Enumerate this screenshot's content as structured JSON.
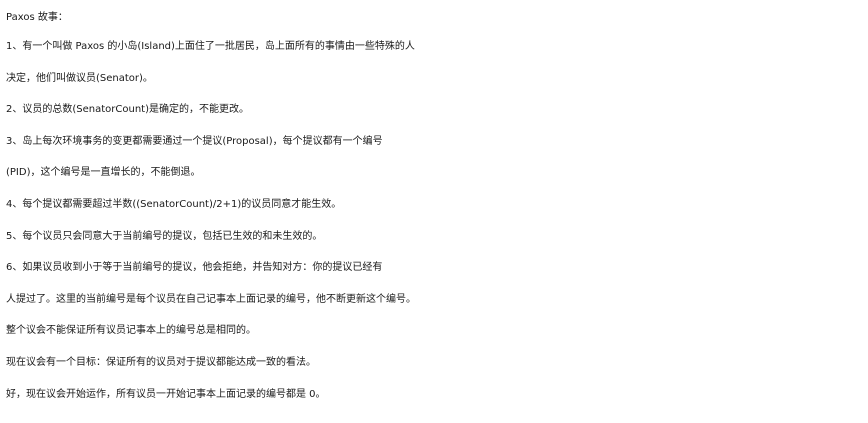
{
  "document": {
    "title": "Paxos  故事：",
    "lines": [
      "1、有一个叫做  Paxos  的小岛(Island)上面住了一批居民，岛上面所有的事情由一些特殊的人",
      "决定，他们叫做议员(Senator)。",
      "2、议员的总数(SenatorCount)是确定的，不能更改。",
      "3、岛上每次环境事务的变更都需要通过一个提议(Proposal)，每个提议都有一个编号",
      "(PID)，这个编号是一直增长的，不能倒退。",
      "4、每个提议都需要超过半数((SenatorCount)/2+1)的议员同意才能生效。",
      "5、每个议员只会同意大于当前编号的提议，包括已生效的和未生效的。",
      "6、如果议员收到小于等于当前编号的提议，他会拒绝，并告知对方：你的提议已经有",
      "人提过了。这里的当前编号是每个议员在自己记事本上面记录的编号，他不断更新这个编号。",
      "整个议会不能保证所有议员记事本上的编号总是相同的。",
      "现在议会有一个目标：保证所有的议员对于提议都能达成一致的看法。",
      "好，现在议会开始运作，所有议员一开始记事本上面记录的编号都是  0。"
    ]
  }
}
